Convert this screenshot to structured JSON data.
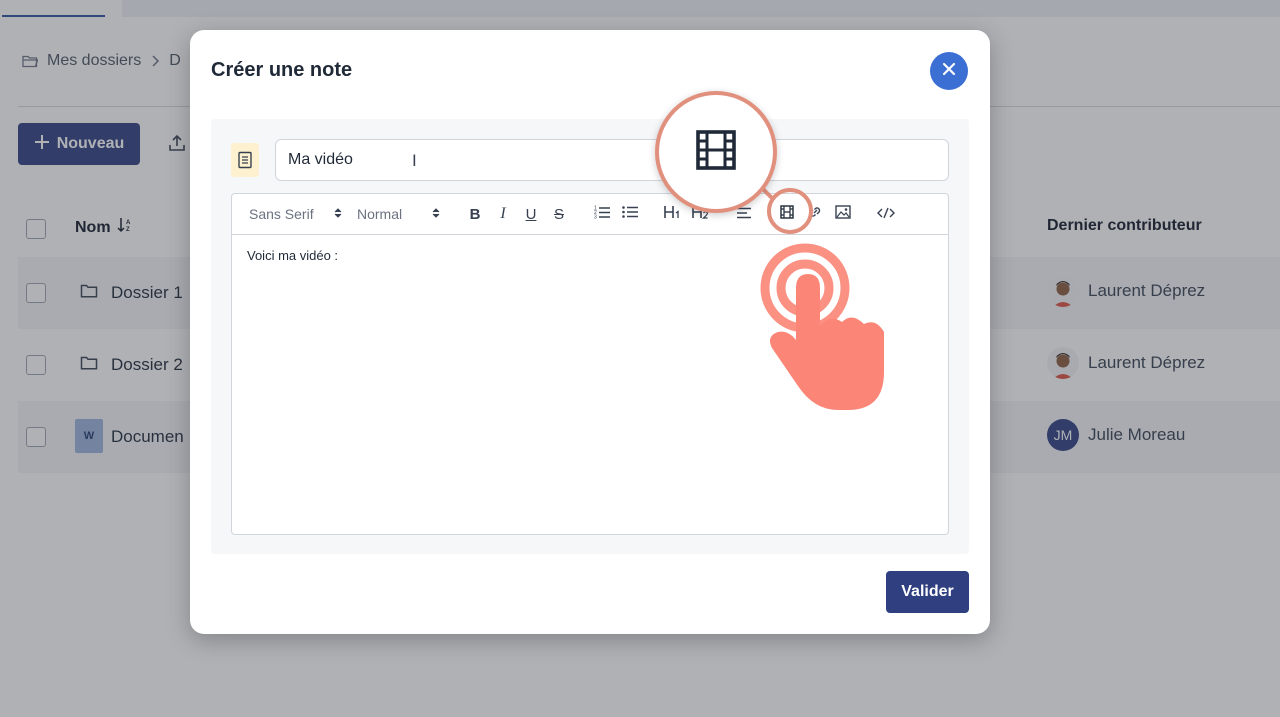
{
  "background": {
    "breadcrumb": {
      "root": "Mes dossiers",
      "current": "D"
    },
    "new_button": "Nouveau",
    "table": {
      "col_name": "Nom",
      "col_contributor": "Dernier contributeur",
      "rows": [
        {
          "name": "Dossier 1",
          "type": "folder",
          "contributor": "Laurent Déprez",
          "avatar": "illustrated"
        },
        {
          "name": "Dossier 2",
          "type": "folder",
          "contributor": "Laurent Déprez",
          "avatar": "illustrated"
        },
        {
          "name": "Documen",
          "type": "word-doc",
          "badge": "W",
          "contributor": "Julie Moreau",
          "avatar": "JM"
        }
      ]
    }
  },
  "modal": {
    "title": "Créer une note",
    "note_title_value": "Ma vidéo",
    "toolbar": {
      "font_select": "Sans Serif",
      "size_select": "Normal",
      "buttons": [
        "bold",
        "italic",
        "underline",
        "strikethrough",
        "ordered-list",
        "bullet-list",
        "h1",
        "h2",
        "align",
        "video",
        "link",
        "image",
        "code"
      ]
    },
    "editor_content": "Voici ma vidéo :",
    "validate_button": "Valider"
  },
  "colors": {
    "primary": "#2f3f80",
    "close_button": "#3b6fd4",
    "annotation": "#e2907e",
    "hand": "#fb8576"
  }
}
